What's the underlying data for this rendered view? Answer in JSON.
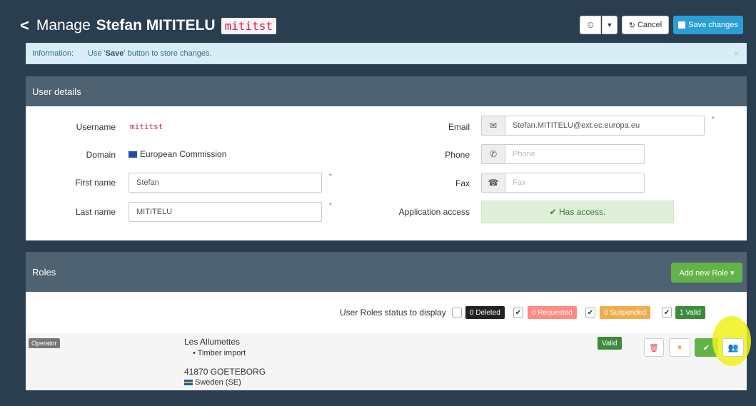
{
  "header": {
    "back_glyph": "<",
    "manage": "Manage",
    "name": "Stefan MITITELU",
    "username_code": "mititst",
    "history_icon": "history-icon",
    "cancel_label": "Cancel",
    "save_label": "Save changes"
  },
  "info": {
    "label": "Information:",
    "text_prefix": "Use '",
    "text_bold": "Save",
    "text_suffix": "' button to store changes.",
    "close_glyph": "×"
  },
  "user_details": {
    "title": "User details",
    "username_label": "Username",
    "username_value": "mititst",
    "domain_label": "Domain",
    "domain_value": "European Commission",
    "first_name_label": "First name",
    "first_name_value": "Stefan",
    "last_name_label": "Last name",
    "last_name_value": "MITITELU",
    "email_label": "Email",
    "email_value": "Stefan.MITITELU@ext.ec.europa.eu",
    "phone_label": "Phone",
    "phone_placeholder": "Phone",
    "fax_label": "Fax",
    "fax_placeholder": "Fax",
    "app_access_label": "Application access",
    "app_access_value": "✔ Has access.",
    "required_mark": "*"
  },
  "roles": {
    "title": "Roles",
    "add_label": "Add new Role ▾",
    "status_label": "User Roles status to display",
    "filters": [
      {
        "label": "0 Deleted",
        "checked": false,
        "color": "#222222"
      },
      {
        "label": "0 Requested",
        "checked": true,
        "color": "#ff8a80"
      },
      {
        "label": "0 Suspended",
        "checked": true,
        "color": "#f0ad4e"
      },
      {
        "label": "1 Valid",
        "checked": true,
        "color": "#3c8a3a"
      }
    ],
    "row": {
      "type": "Operator",
      "company": "Les Allumettes",
      "bullet": "• Timber import",
      "address": "41870 GOETEBORG",
      "country": "Sweden (SE)",
      "status": "Valid"
    }
  },
  "colors": {
    "background": "#2b3e50",
    "panel_header": "#4e6272",
    "primary": "#2a9fd6",
    "success": "#62b448"
  }
}
